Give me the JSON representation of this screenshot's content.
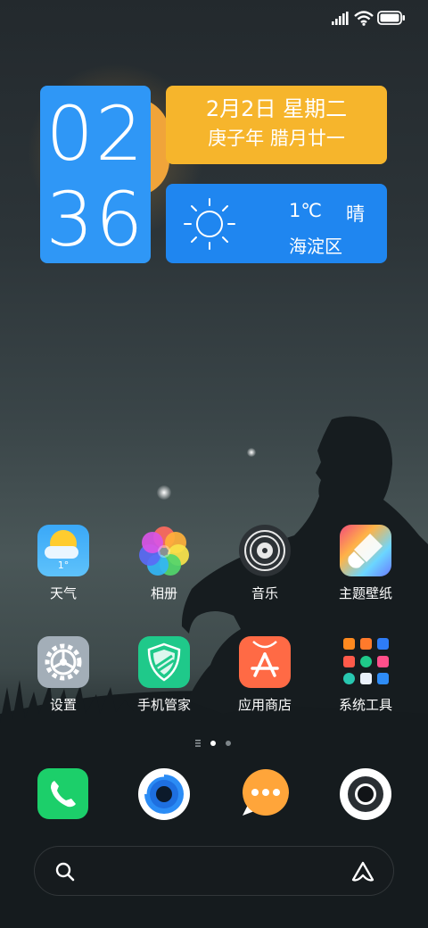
{
  "status_bar": {
    "signal_icon": "signal-bars-icon",
    "wifi_icon": "wifi-icon",
    "battery_icon": "battery-icon"
  },
  "clock_widget": {
    "hour": "02",
    "minute": "36",
    "color": "#2f97f6"
  },
  "date_widget": {
    "date_line": "2月2日 星期二",
    "lunar_line": "庚子年 腊月廿一",
    "color": "#f6b52c"
  },
  "weather_widget": {
    "icon": "sun-icon",
    "temperature": "1℃",
    "condition": "晴",
    "location": "海淀区",
    "color": "#1f86f0"
  },
  "apps": [
    {
      "label": "天气",
      "icon": "weather-app-icon",
      "badge": "1°"
    },
    {
      "label": "相册",
      "icon": "gallery-app-icon"
    },
    {
      "label": "音乐",
      "icon": "music-app-icon"
    },
    {
      "label": "主题壁纸",
      "icon": "themes-app-icon"
    },
    {
      "label": "设置",
      "icon": "settings-app-icon"
    },
    {
      "label": "手机管家",
      "icon": "security-app-icon"
    },
    {
      "label": "应用商店",
      "icon": "app-store-icon"
    },
    {
      "label": "系统工具",
      "icon": "system-tools-folder-icon"
    }
  ],
  "page_indicator": {
    "pages": 3,
    "current": 2
  },
  "dock": [
    {
      "name": "phone",
      "icon": "phone-app-icon"
    },
    {
      "name": "browser",
      "icon": "browser-app-icon"
    },
    {
      "name": "messages",
      "icon": "messages-app-icon"
    },
    {
      "name": "camera",
      "icon": "camera-app-icon"
    }
  ],
  "search_bar": {
    "search_icon": "search-icon",
    "assistant_icon": "assistant-icon"
  }
}
